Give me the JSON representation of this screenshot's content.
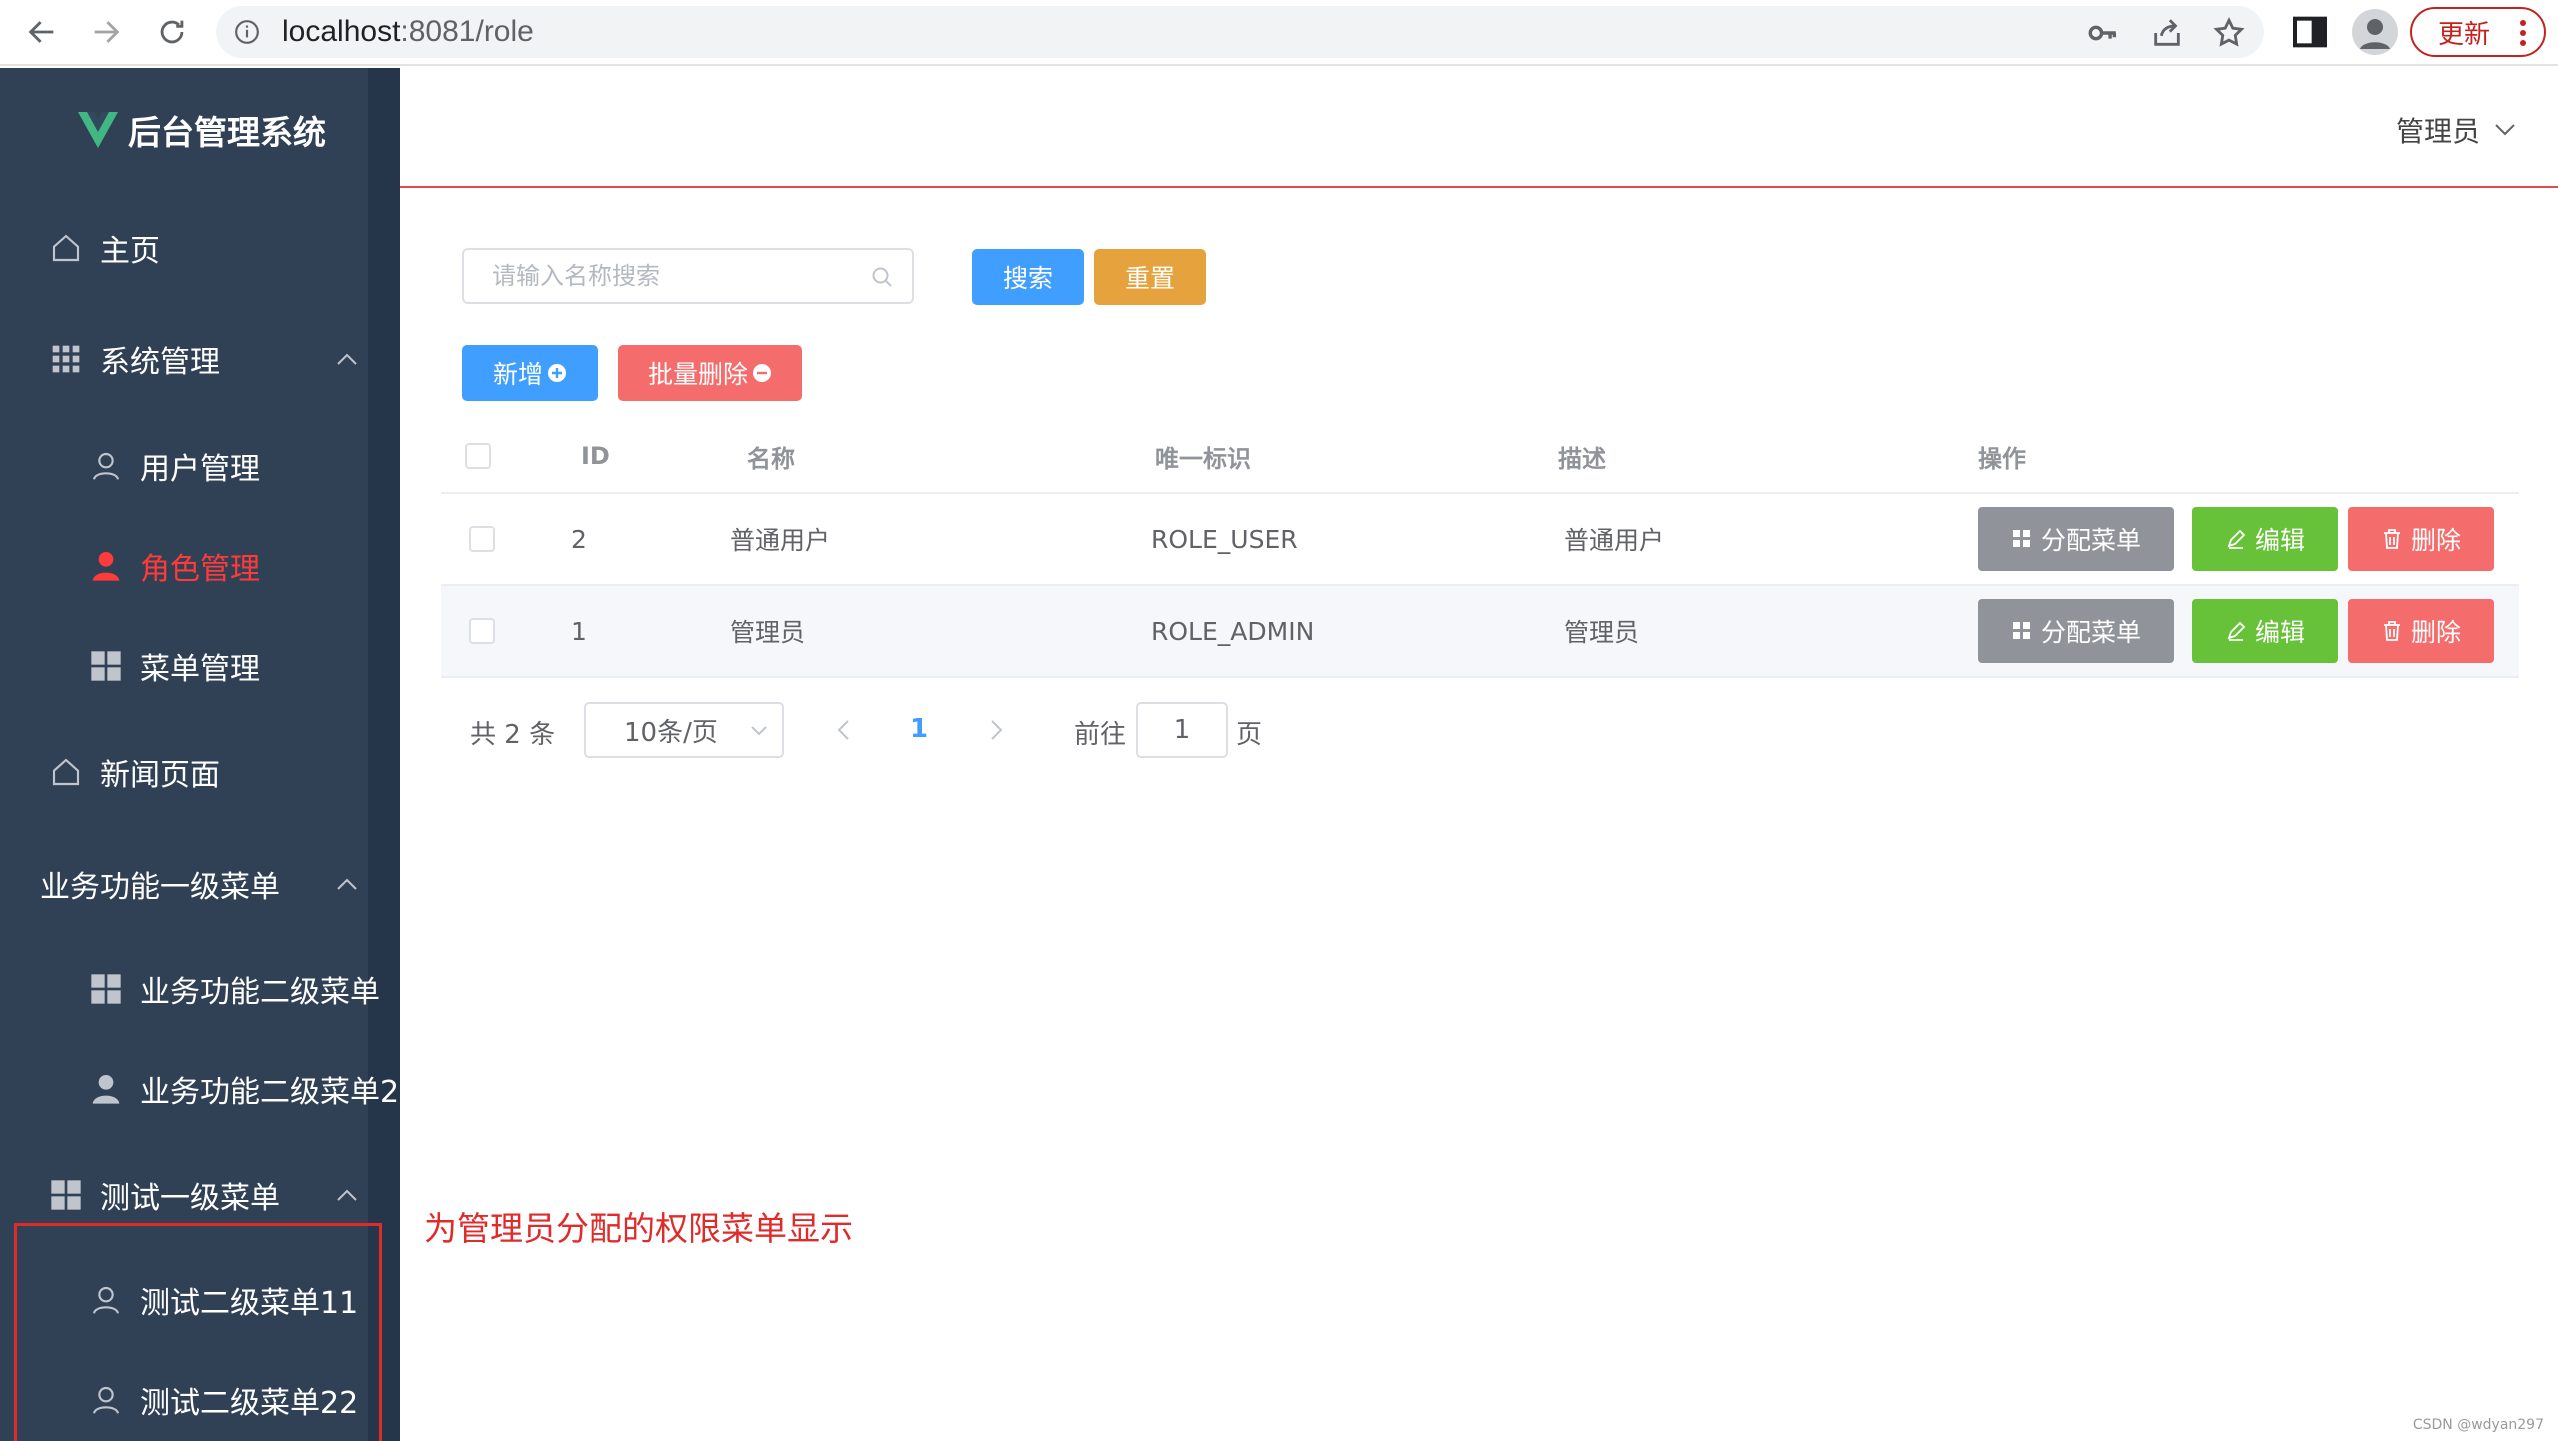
{
  "browser": {
    "url_host": "localhost",
    "url_path": ":8081/role",
    "update_label": "更新"
  },
  "sidebar": {
    "logo_text": "后台管理系统",
    "items": [
      {
        "label": "主页",
        "icon": "home-icon",
        "level": 1
      },
      {
        "label": "系统管理",
        "icon": "grid-icon",
        "level": 1,
        "expanded": true
      },
      {
        "label": "用户管理",
        "icon": "user-outline-icon",
        "level": 2
      },
      {
        "label": "角色管理",
        "icon": "user-filled-icon",
        "level": 2,
        "active": true
      },
      {
        "label": "菜单管理",
        "icon": "grid-icon",
        "level": 2
      },
      {
        "label": "新闻页面",
        "icon": "home-icon",
        "level": 1
      },
      {
        "label": "业务功能一级菜单",
        "icon": "",
        "level": 1,
        "expanded": true
      },
      {
        "label": "业务功能二级菜单",
        "icon": "grid-icon",
        "level": 2
      },
      {
        "label": "业务功能二级菜单2",
        "icon": "user-filled-icon",
        "level": 2
      },
      {
        "label": "测试一级菜单",
        "icon": "grid-icon",
        "level": 1,
        "expanded": true
      },
      {
        "label": "测试二级菜单11",
        "icon": "user-outline-icon",
        "level": 2
      },
      {
        "label": "测试二级菜单22",
        "icon": "user-outline-icon",
        "level": 2
      }
    ]
  },
  "header": {
    "user_label": "管理员"
  },
  "toolbar": {
    "search_placeholder": "请输入名称搜索",
    "search_label": "搜索",
    "reset_label": "重置",
    "add_label": "新增",
    "batch_delete_label": "批量删除"
  },
  "table": {
    "columns": [
      "ID",
      "名称",
      "唯一标识",
      "描述",
      "操作"
    ],
    "rows": [
      {
        "id": "2",
        "name": "普通用户",
        "flag": "ROLE_USER",
        "desc": "普通用户"
      },
      {
        "id": "1",
        "name": "管理员",
        "flag": "ROLE_ADMIN",
        "desc": "管理员"
      }
    ],
    "actions": {
      "assign": "分配菜单",
      "edit": "编辑",
      "delete": "删除"
    }
  },
  "pagination": {
    "total": "共 2 条",
    "page_size": "10条/页",
    "current_page": "1",
    "goto_prefix": "前往",
    "goto_value": "1",
    "goto_suffix": "页"
  },
  "annotation": "为管理员分配的权限菜单显示",
  "watermark": "CSDN @wdyan297",
  "colors": {
    "sidebar_bg": "#304156",
    "primary": "#409eff",
    "warning": "#e6a23c",
    "danger": "#f56c6c",
    "success": "#67c23a",
    "info": "#909399",
    "active_menu": "#ff3a3a"
  }
}
